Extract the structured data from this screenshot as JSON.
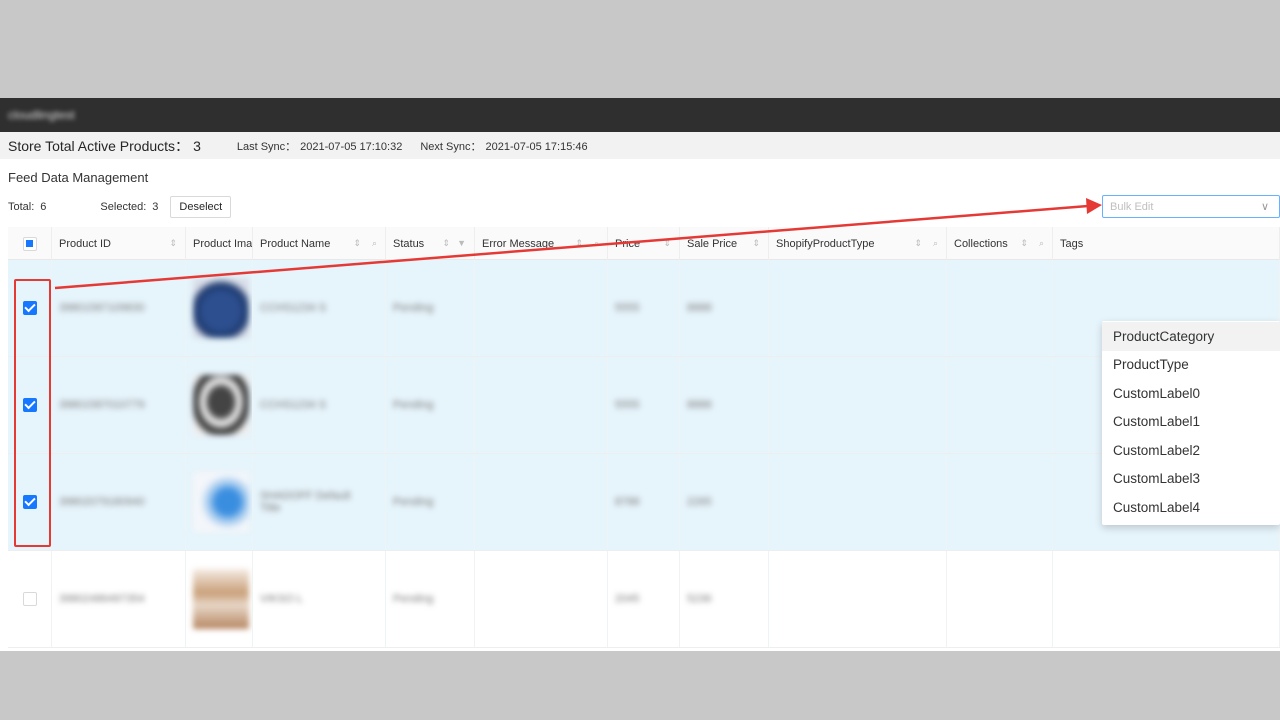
{
  "app": {
    "title": "cloudlingtest"
  },
  "sync": {
    "total_label": "Store Total Active Products：",
    "total_value": "3",
    "last_label": "Last Sync：",
    "last_value": "2021-07-05 17:10:32",
    "next_label": "Next Sync：",
    "next_value": "2021-07-05 17:15:46"
  },
  "section": {
    "title": "Feed Data Management"
  },
  "counts": {
    "total_label": "Total:",
    "total_value": "6",
    "selected_label": "Selected:",
    "selected_value": "3",
    "deselect_label": "Deselect"
  },
  "bulk_edit": {
    "placeholder": "Bulk Edit",
    "options": [
      "ProductCategory",
      "ProductType",
      "CustomLabel0",
      "CustomLabel1",
      "CustomLabel2",
      "CustomLabel3",
      "CustomLabel4"
    ]
  },
  "table": {
    "columns": [
      "Product ID",
      "Product Ima",
      "Product Name",
      "Status",
      "Error Message",
      "Price",
      "Sale Price",
      "ShopifyProductType",
      "Collections",
      "Tags"
    ],
    "rows": [
      {
        "checked": true,
        "id": "39801587109830",
        "name": "CCHS1234 S",
        "status": "Pending",
        "price": "5555",
        "sale": "8888"
      },
      {
        "checked": true,
        "id": "39801587010779",
        "name": "CCHS1234 S",
        "status": "Pending",
        "price": "5555",
        "sale": "8888"
      },
      {
        "checked": true,
        "id": "39802079180940",
        "name": "SHADOFF Default Title",
        "status": "Pending",
        "price": "8788",
        "sale": "2265"
      },
      {
        "checked": false,
        "id": "39802486497354",
        "name": "VIKSO L",
        "status": "Pending",
        "price": "2045",
        "sale": "5236"
      }
    ]
  },
  "colors": {
    "accent": "#1677ff",
    "annotation": "#e53935",
    "selected_row": "#e6f4fb"
  }
}
